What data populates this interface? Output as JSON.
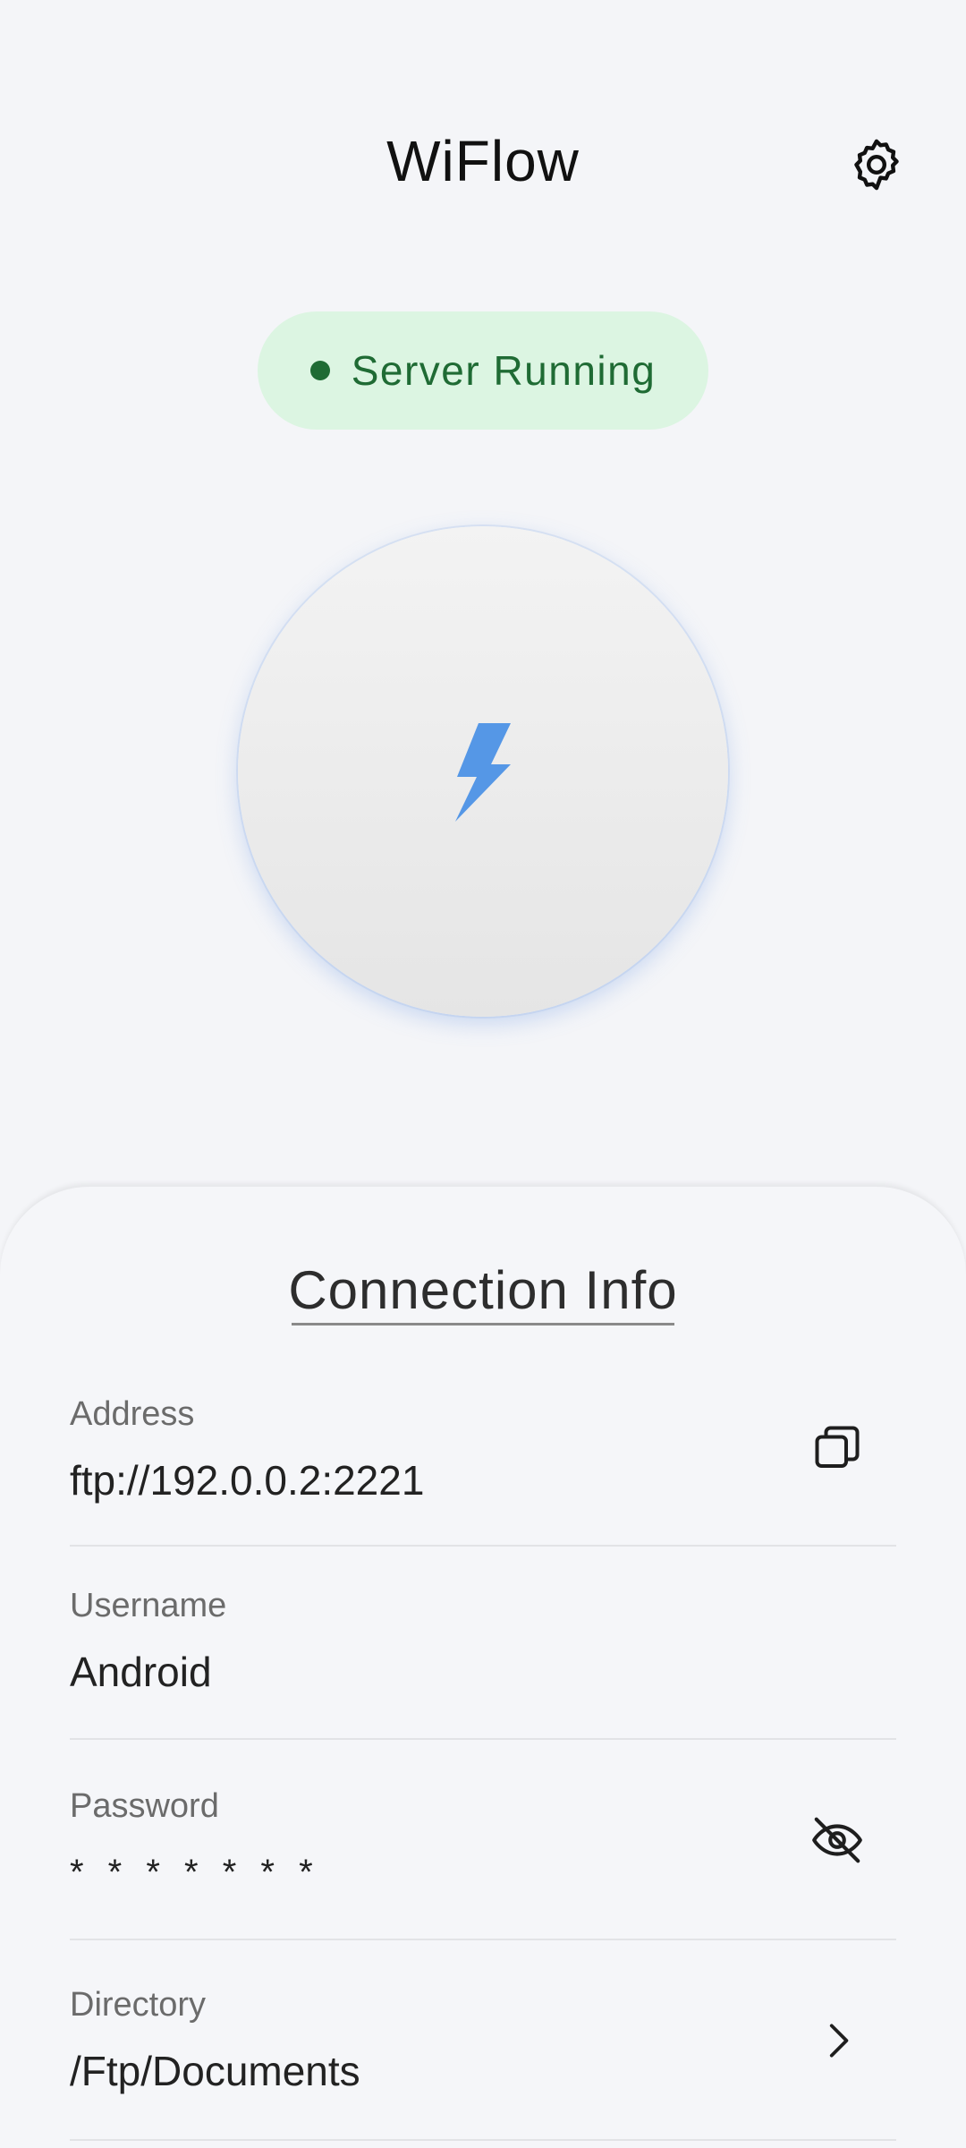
{
  "header": {
    "title": "WiFlow",
    "settings_icon": "gear-icon"
  },
  "status": {
    "text": "Server Running",
    "color": "#1f6b34",
    "background": "#dcf5e2"
  },
  "power_button": {
    "icon": "lightning-bolt-icon",
    "accent": "#4a90e2"
  },
  "connection_info": {
    "title": "Connection Info",
    "rows": [
      {
        "label": "Address",
        "value": "ftp://192.0.0.2:2221",
        "action_icon": "copy-icon"
      },
      {
        "label": "Username",
        "value": "Android"
      },
      {
        "label": "Password",
        "value": "* * * * * * *",
        "action_icon": "eye-off-icon"
      },
      {
        "label": "Directory",
        "value": "/Ftp/Documents",
        "action_icon": "chevron-right-icon"
      }
    ]
  }
}
